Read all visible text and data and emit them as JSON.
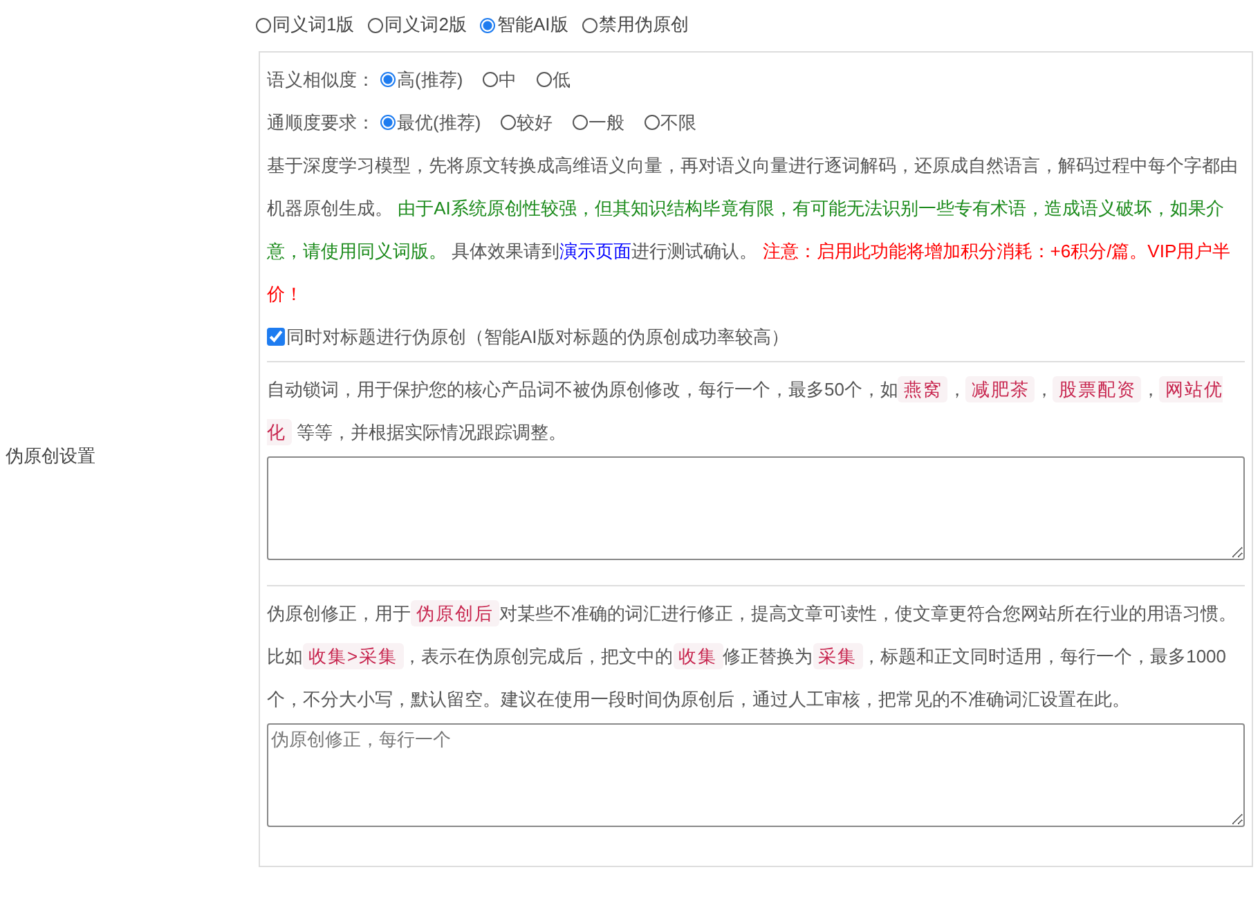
{
  "section_label": "伪原创设置",
  "modes": [
    {
      "label": "同义词1版",
      "selected": false
    },
    {
      "label": "同义词2版",
      "selected": false
    },
    {
      "label": "智能AI版",
      "selected": true
    },
    {
      "label": "禁用伪原创",
      "selected": false
    }
  ],
  "similarity": {
    "label": "语义相似度：",
    "options": [
      {
        "label": "高(推荐)",
        "selected": true
      },
      {
        "label": "中",
        "selected": false
      },
      {
        "label": "低",
        "selected": false
      }
    ]
  },
  "fluency": {
    "label": "通顺度要求：",
    "options": [
      {
        "label": "最优(推荐)",
        "selected": true
      },
      {
        "label": "较好",
        "selected": false
      },
      {
        "label": "一般",
        "selected": false
      },
      {
        "label": "不限",
        "selected": false
      }
    ]
  },
  "description": [
    {
      "kind": "text",
      "text": "基于深度学习模型，先将原文转换成高维语义向量，再对语义向量进行逐词解码，还原成自然语言，解码过程中每个字都由机器原创生成。 "
    },
    {
      "kind": "note",
      "text": "由于AI系统原创性较强，但其知识结构毕竟有限，有可能无法识别一些专有术语，造成语义破坏，如果介意，请使用同义词版。"
    },
    {
      "kind": "text",
      "text": " 具体效果请到"
    },
    {
      "kind": "link",
      "text": "演示页面"
    },
    {
      "kind": "text",
      "text": "进行测试确认。 "
    },
    {
      "kind": "warning",
      "text": "注意：启用此功能将增加积分消耗：+6积分/篇。VIP用户半价！"
    }
  ],
  "title_option": {
    "label": "同时对标题进行伪原创（智能AI版对标题的伪原创成功率较高）",
    "checked": true
  },
  "lock_words": {
    "help": [
      {
        "kind": "text",
        "text": "自动锁词，用于保护您的核心产品词不被伪原创修改，每行一个，最多50个，如"
      },
      {
        "kind": "tag",
        "text": "燕窝"
      },
      {
        "kind": "text",
        "text": "，"
      },
      {
        "kind": "tag",
        "text": "减肥茶"
      },
      {
        "kind": "text",
        "text": "，"
      },
      {
        "kind": "tag",
        "text": "股票配资"
      },
      {
        "kind": "text",
        "text": "，"
      },
      {
        "kind": "tag",
        "text": "网站优化"
      },
      {
        "kind": "text",
        "text": " 等等，并根据实际情况跟踪调整。"
      }
    ]
  },
  "corrections": {
    "help": [
      {
        "kind": "text",
        "text": "伪原创修正，用于"
      },
      {
        "kind": "tag",
        "text": "伪原创后"
      },
      {
        "kind": "text",
        "text": "对某些不准确的词汇进行修正，提高文章可读性，使文章更符合您网站所在行业的用语习惯。比如"
      },
      {
        "kind": "tag",
        "text": "收集>采集"
      },
      {
        "kind": "text",
        "text": "，表示在伪原创完成后，把文中的"
      },
      {
        "kind": "tag",
        "text": "收集"
      },
      {
        "kind": "text",
        "text": "修正替换为"
      },
      {
        "kind": "tag",
        "text": "采集"
      },
      {
        "kind": "text",
        "text": "，标题和正文同时适用，每行一个，最多1000个，不分大小写，默认留空。建议在使用一段时间伪原创后，通过人工审核，把常见的不准确词汇设置在此。"
      }
    ],
    "placeholder": "伪原创修正，每行一个"
  }
}
